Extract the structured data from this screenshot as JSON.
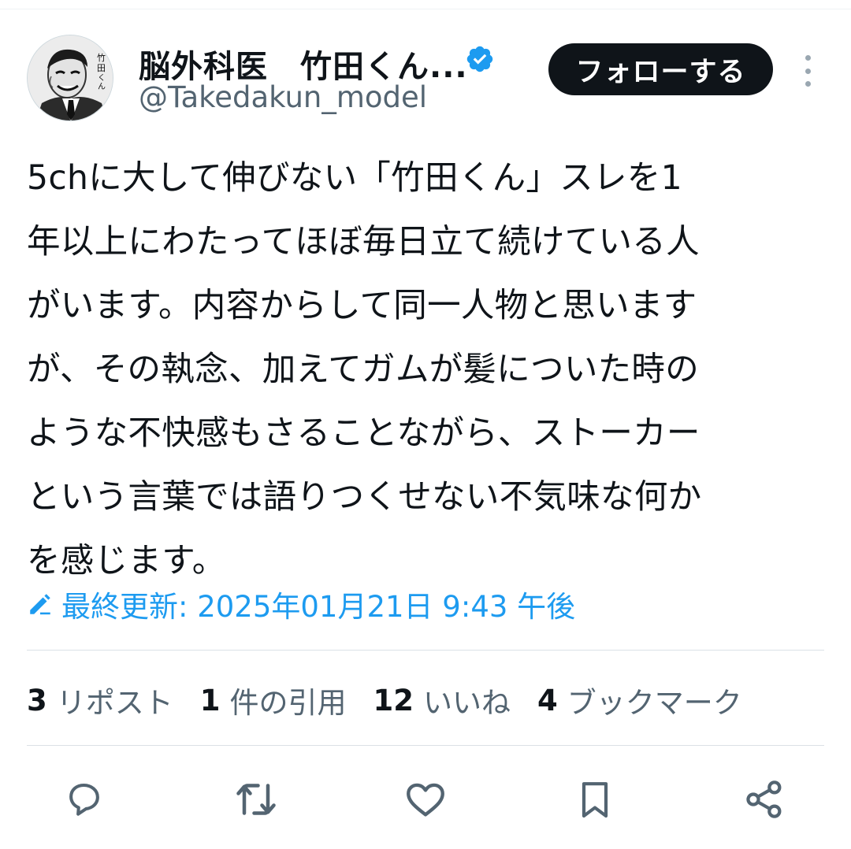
{
  "author": {
    "display_name": "脳外科医　竹田くん...",
    "handle": "@Takedakun_model",
    "verified": true,
    "avatar_text": "竹田くん"
  },
  "follow_button": {
    "label": "フォローする"
  },
  "tweet": {
    "text": "5chに大して伸びない「竹田くん」スレを1\n年以上にわたってほぼ毎日立て続けている人\nがいます。内容からして同一人物と思います\nが、その執念、加えてガムが髪についた時の\nような不快感もさることながら、ストーカー\nという言葉では語りつくせない不気味な何か\nを感じます。",
    "edited_label": "最終更新: 2025年01月21日 9:43 午後"
  },
  "stats": [
    {
      "count": "3",
      "label": "リポスト"
    },
    {
      "count": "1",
      "label": "件の引用"
    },
    {
      "count": "12",
      "label": "いいね"
    },
    {
      "count": "4",
      "label": "ブックマーク"
    }
  ],
  "actions": [
    {
      "icon": "reply-icon"
    },
    {
      "icon": "retweet-icon"
    },
    {
      "icon": "like-icon"
    },
    {
      "icon": "bookmark-icon"
    },
    {
      "icon": "share-icon"
    }
  ],
  "colors": {
    "accent": "#1d9bf0",
    "text": "#0f1419",
    "secondary": "#536471",
    "follow_bg": "#0f1419"
  }
}
